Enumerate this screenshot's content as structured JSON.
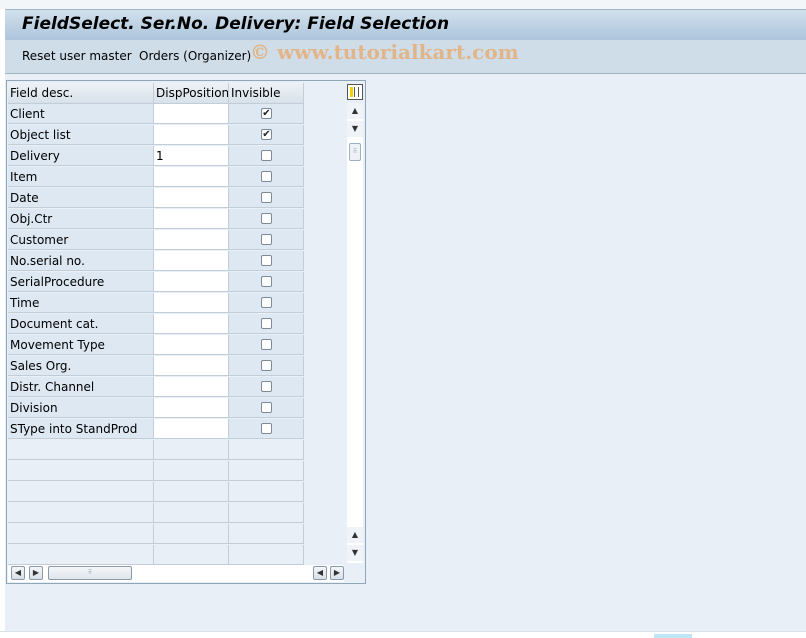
{
  "window": {
    "title": "FieldSelect. Ser.No. Delivery: Field Selection"
  },
  "toolbar": {
    "reset_label": "Reset user master",
    "orders_label": "Orders (Organizer)",
    "watermark": "© www.tutorialkart.com"
  },
  "table": {
    "columns": [
      "Field desc.",
      "DispPosition",
      "Invisible"
    ],
    "rows": [
      {
        "field": "Client",
        "position": "",
        "invisible": true
      },
      {
        "field": "Object list",
        "position": "",
        "invisible": true
      },
      {
        "field": "Delivery",
        "position": "1",
        "invisible": false
      },
      {
        "field": "Item",
        "position": "",
        "invisible": false
      },
      {
        "field": "Date",
        "position": "",
        "invisible": false
      },
      {
        "field": "Obj.Ctr",
        "position": "",
        "invisible": false
      },
      {
        "field": "Customer",
        "position": "",
        "invisible": false
      },
      {
        "field": "No.serial no.",
        "position": "",
        "invisible": false
      },
      {
        "field": "SerialProcedure",
        "position": "",
        "invisible": false
      },
      {
        "field": "Time",
        "position": "",
        "invisible": false
      },
      {
        "field": "Document cat.",
        "position": "",
        "invisible": false
      },
      {
        "field": "Movement Type",
        "position": "",
        "invisible": false
      },
      {
        "field": "Sales Org.",
        "position": "",
        "invisible": false
      },
      {
        "field": "Distr. Channel",
        "position": "",
        "invisible": false
      },
      {
        "field": "Division",
        "position": "",
        "invisible": false
      },
      {
        "field": "SType into StandProd",
        "position": "",
        "invisible": false
      }
    ],
    "empty_rows": 6,
    "check_glyph": "✔"
  },
  "icons": {
    "column_config": "column-configuration-icon",
    "scroll_up": "▲",
    "scroll_down": "▼",
    "scroll_left": "◀",
    "scroll_right": "▶",
    "grip": "⠿"
  }
}
